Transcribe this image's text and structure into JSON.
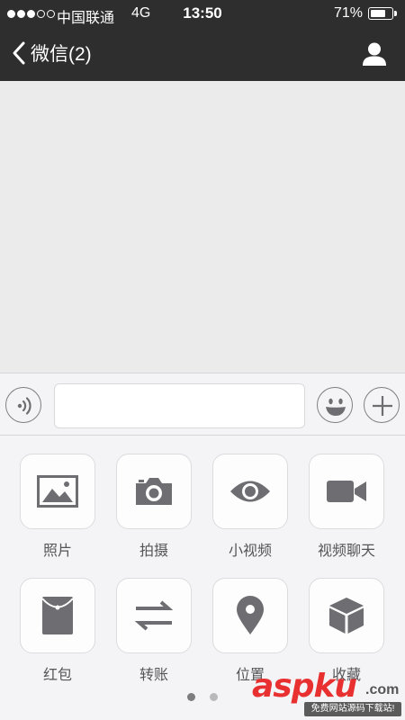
{
  "status_bar": {
    "carrier": "中国联通",
    "network": "4G",
    "time": "13:50",
    "battery": "71%",
    "battery_level": 0.71
  },
  "nav": {
    "title": "微信(2)",
    "back_icon": "chevron-left-icon",
    "profile_icon": "person-icon"
  },
  "input_bar": {
    "voice_icon": "voice-icon",
    "text_value": "",
    "emoji_icon": "emoji-icon",
    "plus_icon": "plus-icon"
  },
  "panel": {
    "items": [
      {
        "label": "照片",
        "icon": "photo-icon"
      },
      {
        "label": "拍摄",
        "icon": "camera-icon"
      },
      {
        "label": "小视频",
        "icon": "eye-icon"
      },
      {
        "label": "视频聊天",
        "icon": "video-camera-icon"
      },
      {
        "label": "红包",
        "icon": "red-packet-icon"
      },
      {
        "label": "转账",
        "icon": "transfer-icon"
      },
      {
        "label": "位置",
        "icon": "location-icon"
      },
      {
        "label": "收藏",
        "icon": "favorites-cube-icon"
      }
    ],
    "page_count": 2,
    "active_page": 1
  },
  "watermark": {
    "brand": "aspku",
    "domain": ".com",
    "tagline": "免费网站源码下载站!"
  },
  "colors": {
    "nav_bg": "#2e2e2e",
    "chat_bg": "#ebebeb",
    "panel_bg": "#f4f4f6",
    "icon_gray": "#6e6e72",
    "watermark_red": "#e83030"
  }
}
